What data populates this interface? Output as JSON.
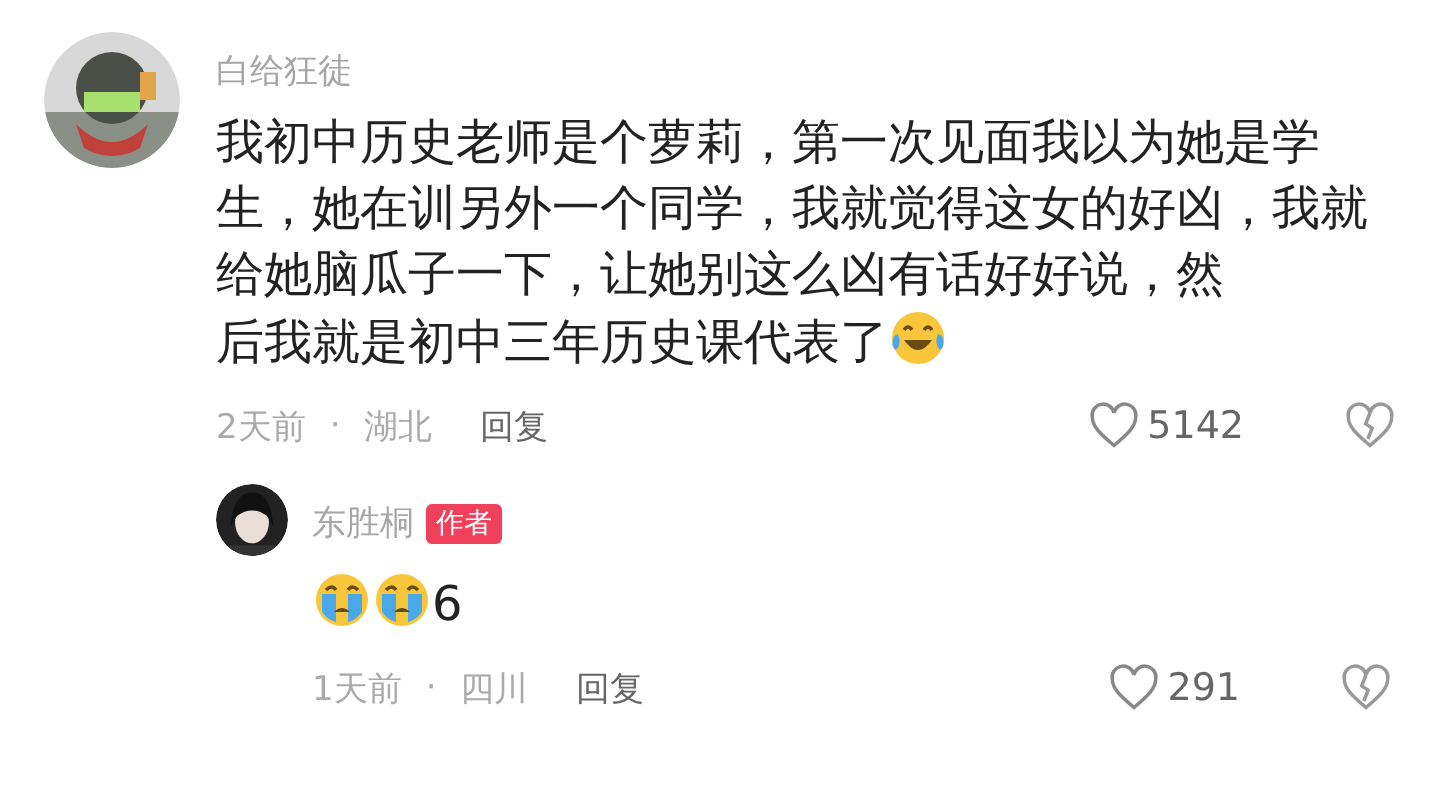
{
  "comments": [
    {
      "user": "白给狂徒",
      "content": [
        {
          "kind": "text",
          "text": "我初中历史老师是个萝莉，第一次见面我以为她是学生，她在训另外一个同学，我就觉得这女的好凶，我就给她脑瓜子一下，让她别这么凶有话好好说，然"
        },
        {
          "kind": "text",
          "text": "后我就是初中三年历史课代表了"
        },
        {
          "kind": "laughing-emoji"
        }
      ],
      "time": "2天前",
      "separator": "·",
      "location": "湖北",
      "reply": "回复",
      "likes": "5142",
      "replies": [
        {
          "user": "东胜桐",
          "badge": "作者",
          "content": [
            {
              "kind": "crying-emoji"
            },
            {
              "kind": "crying-emoji"
            },
            {
              "kind": "text",
              "text": "6"
            }
          ],
          "time": "1天前",
          "separator": "·",
          "location": "四川",
          "reply": "回复",
          "likes": "291"
        }
      ]
    }
  ]
}
